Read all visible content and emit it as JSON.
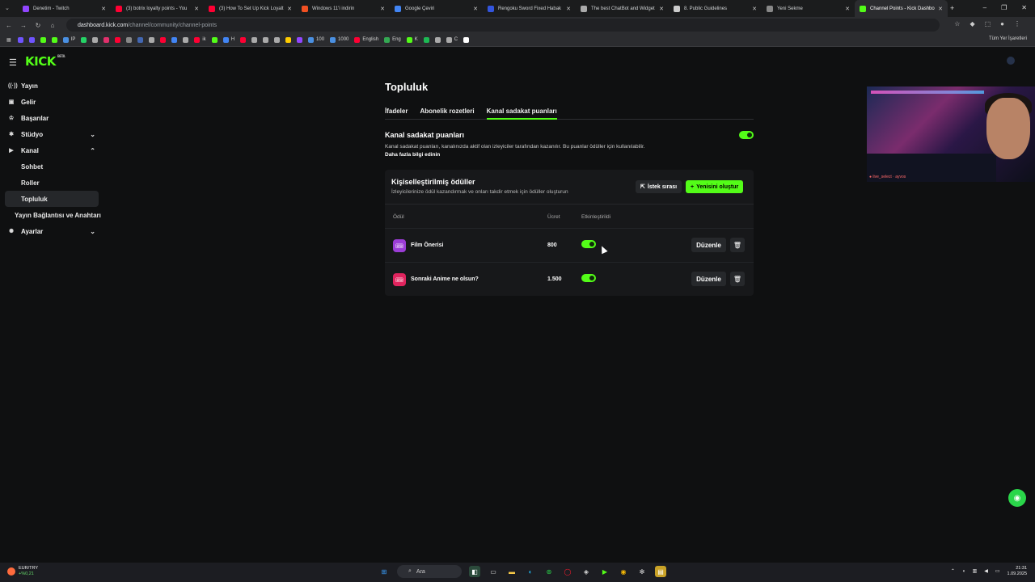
{
  "browser": {
    "tabs": [
      {
        "label": "Denetim - Twitch",
        "color": "#9146ff"
      },
      {
        "label": "(3) botrix loyalty points - You",
        "color": "#ff0033"
      },
      {
        "label": "(3) How To Set Up Kick Loyalt",
        "color": "#ff0033"
      },
      {
        "label": "Windows 11'i indirin",
        "color": "#f25022"
      },
      {
        "label": "Google Çeviri",
        "color": "#4285f4"
      },
      {
        "label": "Rengoku Sword Fixed Habak",
        "color": "#3355dd"
      },
      {
        "label": "The best ChatBot and Widget",
        "color": "#aaaaaa"
      },
      {
        "label": "8. Public Guidelines",
        "color": "#cccccc"
      },
      {
        "label": "Yeni Sekme",
        "color": "#888888"
      },
      {
        "label": "Channel Points - Kick Dashbo",
        "color": "#53fc18"
      }
    ],
    "url_host": "dashboard.kick.com",
    "url_path": "/channel/community/channel-points",
    "bookmarks": [
      {
        "label": "",
        "color": "#6f54ff"
      },
      {
        "label": "",
        "color": "#6f54ff"
      },
      {
        "label": "",
        "color": "#53fc18"
      },
      {
        "label": "",
        "color": "#53fc18"
      },
      {
        "label": "IP",
        "color": "#4a90e2"
      },
      {
        "label": "",
        "color": "#25d366"
      },
      {
        "label": "",
        "color": "#aaaaaa"
      },
      {
        "label": "",
        "color": "#e1306c"
      },
      {
        "label": "",
        "color": "#ff0033"
      },
      {
        "label": "",
        "color": "#888888"
      },
      {
        "label": "",
        "color": "#4267b2"
      },
      {
        "label": "",
        "color": "#aaaaaa"
      },
      {
        "label": "",
        "color": "#ff0033"
      },
      {
        "label": "",
        "color": "#4285f4"
      },
      {
        "label": "",
        "color": "#aaaaaa"
      },
      {
        "label": "ik",
        "color": "#ff0033"
      },
      {
        "label": "",
        "color": "#53fc18"
      },
      {
        "label": "H",
        "color": "#4285f4"
      },
      {
        "label": "",
        "color": "#ff0033"
      },
      {
        "label": "",
        "color": "#aaaaaa"
      },
      {
        "label": "",
        "color": "#aaaaaa"
      },
      {
        "label": "",
        "color": "#aaaaaa"
      },
      {
        "label": "",
        "color": "#ffcc00"
      },
      {
        "label": "",
        "color": "#9146ff"
      },
      {
        "label": "100",
        "color": "#4a90e2"
      },
      {
        "label": "1000",
        "color": "#4a90e2"
      },
      {
        "label": "English",
        "color": "#ff0033"
      },
      {
        "label": "Eng",
        "color": "#34a853"
      },
      {
        "label": "K",
        "color": "#53fc18"
      },
      {
        "label": "",
        "color": "#1db954"
      },
      {
        "label": "",
        "color": "#aaaaaa"
      },
      {
        "label": "C",
        "color": "#aaaaaa"
      },
      {
        "label": "",
        "color": "#ffffff"
      }
    ],
    "all_bookmarks": "Tüm Yer İşaretleri"
  },
  "header": {
    "logo": "KICK",
    "logo_tag": "BETA"
  },
  "sidebar": {
    "items": [
      {
        "label": "Yayın",
        "icon": "broadcast-icon"
      },
      {
        "label": "Gelir",
        "icon": "wallet-icon"
      },
      {
        "label": "Başarılar",
        "icon": "trophy-icon"
      },
      {
        "label": "Stüdyo",
        "icon": "settings-icon"
      },
      {
        "label": "Kanal",
        "icon": "channel-icon"
      }
    ],
    "sub_items": [
      "Sohbet",
      "Roller",
      "Topluluk"
    ],
    "active_sub": "Topluluk",
    "stream_key": "Yayın Bağlantısı ve Anahtarı",
    "settings": "Ayarlar"
  },
  "main": {
    "title": "Topluluk",
    "tabs": [
      "İfadeler",
      "Abonelik rozetleri",
      "Kanal sadakat puanları"
    ],
    "active_tab": "Kanal sadakat puanları",
    "section_title": "Kanal sadakat puanları",
    "section_enabled": true,
    "description": "Kanal sadakat puanları, kanalınızda aktif olan izleyiciler tarafından kazanılır. Bu puanlar ödüller için kullanılabilir.",
    "learn_more": "Daha fazla bilgi edinin",
    "card": {
      "title": "Kişiselleştirilmiş ödüller",
      "subtitle": "İzleyicilerinize ödül kazandırmak ve onları takdir etmek için ödüller oluşturun",
      "queue_button": "İstek sırası",
      "new_button": "Yenisini oluştur",
      "columns": {
        "reward": "Ödül",
        "price": "Ücret",
        "enabled": "Etkinleştirildi"
      },
      "rows": [
        {
          "name": "Film Önerisi",
          "price": "800",
          "enabled": true,
          "icon_color": "#9b3dd6",
          "icon": "ticket-icon"
        },
        {
          "name": "Sonraki Anime ne olsun?",
          "price": "1.500",
          "enabled": true,
          "icon_color": "#e0245e",
          "icon": "ticket-icon"
        }
      ],
      "edit_label": "Düzenle"
    }
  },
  "webcam": {
    "caption": "● live_select · ayvos"
  },
  "taskbar": {
    "currency": "EUR/TRY",
    "change": "+%0,21",
    "search": "Ara",
    "time": "21:31",
    "date": "1.09.2025"
  }
}
